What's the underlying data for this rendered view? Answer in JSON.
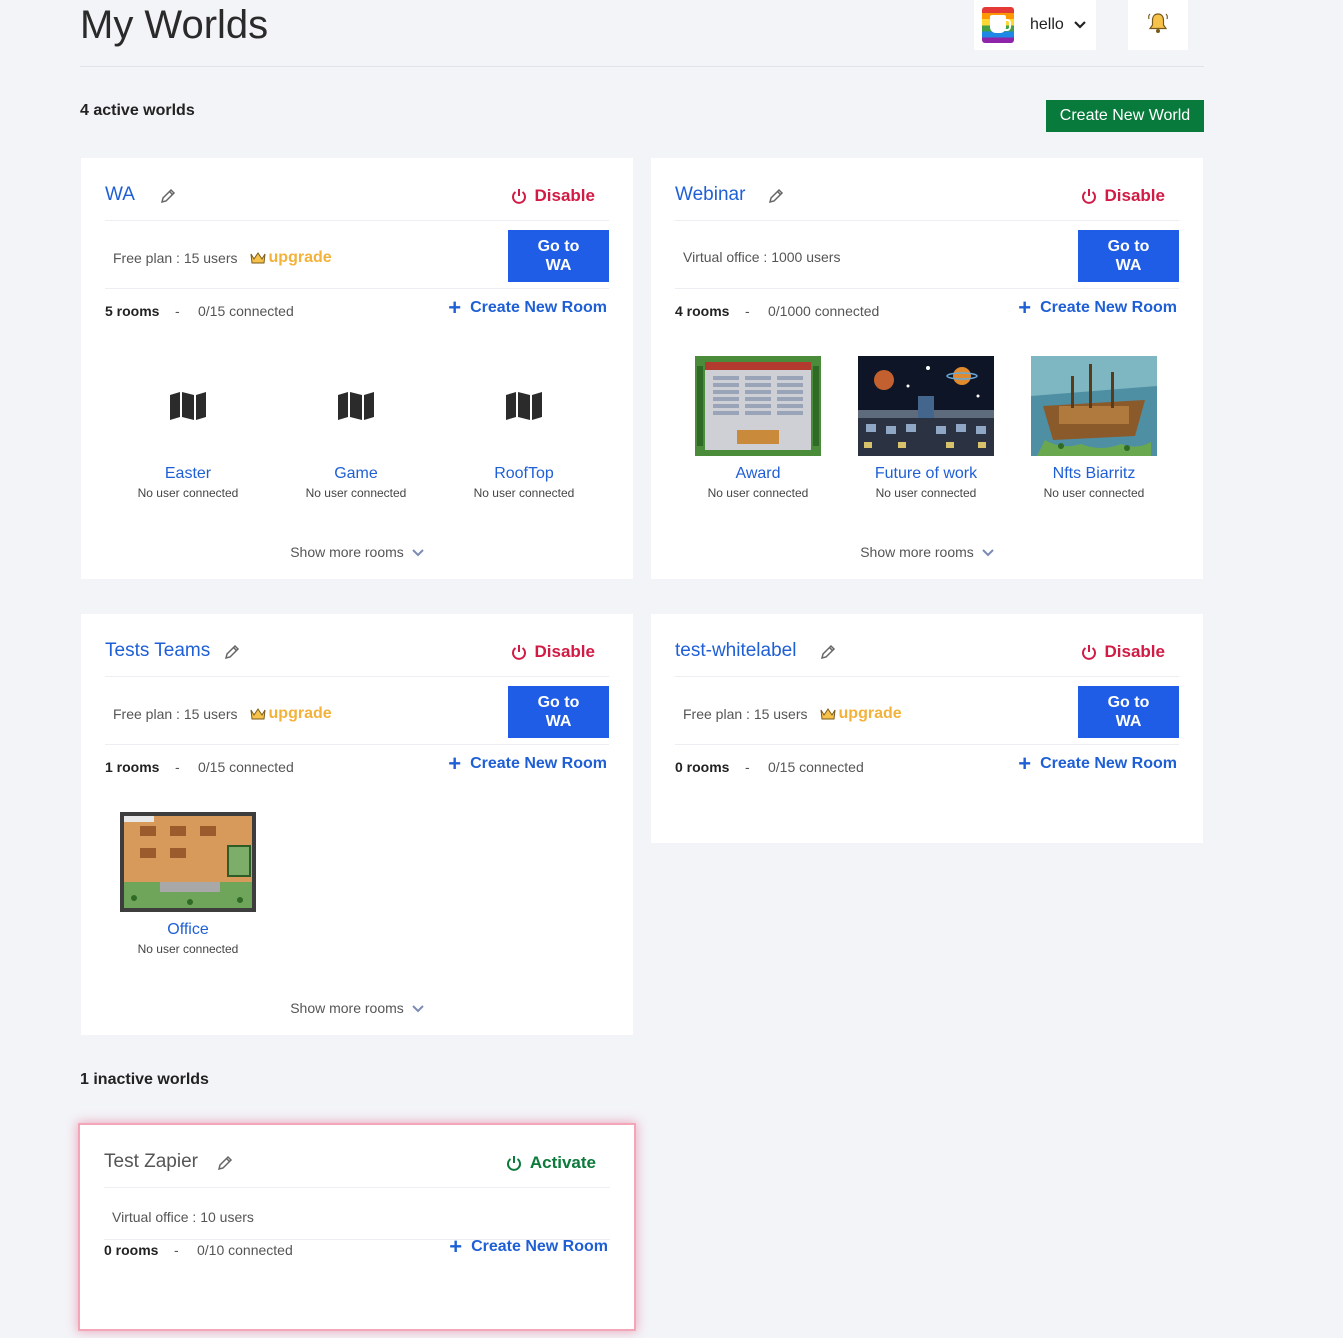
{
  "header": {
    "title": "My Worlds",
    "user_name": "hello"
  },
  "active_section": {
    "label": "4 active worlds",
    "create_world_label": "Create New World"
  },
  "inactive_section": {
    "label": "1 inactive worlds"
  },
  "labels": {
    "disable": "Disable",
    "activate": "Activate",
    "go_to": "Go to WA",
    "upgrade": "upgrade",
    "create_room": "Create New Room",
    "show_more": "Show more rooms",
    "dash": "-"
  },
  "worlds": [
    {
      "name": "WA",
      "plan": "Free plan : 15 users",
      "rooms": "5 rooms",
      "connected": "0/15 connected",
      "room_list": [
        {
          "name": "Easter",
          "status": "No user connected",
          "thumb": "map-icon"
        },
        {
          "name": "Game",
          "status": "No user connected",
          "thumb": "map-icon"
        },
        {
          "name": "RoofTop",
          "status": "No user connected",
          "thumb": "map-icon"
        }
      ]
    },
    {
      "name": "Webinar",
      "plan": "Virtual office : 1000 users",
      "rooms": "4 rooms",
      "connected": "0/1000 connected",
      "room_list": [
        {
          "name": "Award",
          "status": "No user connected",
          "thumb": "auditorium-map"
        },
        {
          "name": "Future of work",
          "status": "No user connected",
          "thumb": "space-map"
        },
        {
          "name": "Nfts Biarritz",
          "status": "No user connected",
          "thumb": "ship-map"
        }
      ]
    },
    {
      "name": "Tests Teams",
      "plan": "Free plan : 15 users",
      "rooms": "1 rooms",
      "connected": "0/15 connected",
      "room_list": [
        {
          "name": "Office",
          "status": "No user connected",
          "thumb": "office-map"
        }
      ]
    },
    {
      "name": "test-whitelabel",
      "plan": "Free plan : 15 users",
      "rooms": "0 rooms",
      "connected": "0/15 connected",
      "room_list": []
    },
    {
      "name": "Test Zapier",
      "plan": "Virtual office : 10 users",
      "rooms": "0 rooms",
      "connected": "0/10 connected",
      "room_list": []
    }
  ],
  "colors": {
    "accent_blue": "#1f5de6",
    "disable_red": "#d11a44",
    "activate_green": "#0b7a3a",
    "create_world_green": "#087b3c",
    "upgrade_orange": "#f3b23a"
  }
}
